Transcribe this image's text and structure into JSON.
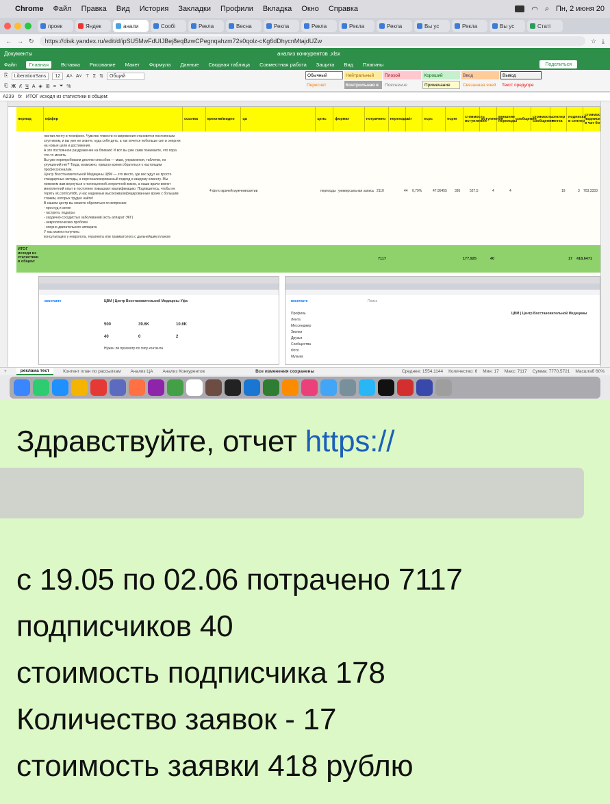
{
  "mac_menubar": {
    "app": "Chrome",
    "items": [
      "Файл",
      "Правка",
      "Вид",
      "История",
      "Закладки",
      "Профили",
      "Вкладка",
      "Окно",
      "Справка"
    ],
    "datetime": "Пн, 2 июня 20"
  },
  "browser": {
    "tabs": [
      "проек",
      "Яндек",
      "анали",
      "Сообі",
      "Рекла",
      "Весна",
      "Рекла",
      "Рекла",
      "Рекла",
      "Рекла",
      "Вы ус",
      "Рекла",
      "Вы ус",
      "Статі"
    ],
    "active_tab_index": 2,
    "url": "https://disk.yandex.ru/edit/d/ipSU5MwFdUIJBej8eqBzwCPegnqahzm72s0qolz-cKg6dDhycnMtajdUZw"
  },
  "spreadsheet": {
    "app_label": "Документы",
    "file_name": "анализ конкурентов .xlsx",
    "share_label": "Поделиться",
    "menus": [
      "Файл",
      "Главная",
      "Вставка",
      "Рисование",
      "Макет",
      "Формула",
      "Данные",
      "Сводная таблица",
      "Совместная работа",
      "Защита",
      "Вид",
      "Плагины"
    ],
    "active_menu": "Главная",
    "font_name": "LiberationSans",
    "font_size": "12",
    "number_format": "Общий",
    "styles_row1": [
      "Обычный",
      "Нейтральный",
      "Плохой",
      "Хороший",
      "Ввод",
      "Вывод"
    ],
    "styles_row2": [
      "Пересчет",
      "Контрольная я",
      "Пояснение",
      "Примечание",
      "Связанная ячей",
      "Текст предупре"
    ],
    "cell_ref": "A239",
    "formula": "ИТОГ исходя из статистики в общем:",
    "headers": [
      "период",
      "оффер",
      "ссылка",
      "креатив/видео",
      "ца",
      "цель",
      "формат",
      "потрачено",
      "переходы",
      "ctr",
      "ecpc",
      "ecpm",
      "стоимость вступления",
      "вступления",
      "внешние переходы",
      "сообщения",
      "стоимость сообщения",
      "сенлер метка",
      "подписки в сенлер",
      "стоимость подписки в чат бот"
    ],
    "offer_text": [
      "листая ленту в телефоне. Чувство тяжести и напряжения становятся постоянным",
      "спутником, и вы уже не знаете, куда себя деть, а так хочется побольше сил и энергии",
      "на новые цели и достижения.",
      "А это постоянное раздражение на близких! И вот вы уже сами понимаете, что пора",
      "что-то менять.",
      "Вы уже перепробовали десятки способов — мази, упражнения, таблетки, но",
      "улучшений нет? Тогда, возможно, пришло время обратиться к настоящим",
      "профессионалам.",
      "Центр Восстановительной Медицины ЦВМ — это место, где вас ждут не просто",
      "стандартные методы, а персонализированный подход к каждому клиенту. Мы",
      "поможем вам вернуться к полноценной энергичной жизни, а наши врачи имеют",
      "многолетний опыт и постоянно повышают квалификацию. Подпишитесь, чтобы не",
      "терять vk.com/cvm86, у нас надежные высококвалифицированные врачи с большим",
      "стажем, которых трудно найти!",
      "В нашем центр вы можете обратиться по вопросам:",
      "- простуд и ангин",
      "- гастрита, подагры",
      "- сердечно-сосудистых заболеваний (есть аппарат ЭКГ)",
      "- неврологических проблем",
      "- опорно-двигательного аппарата",
      "У нас можно получить:",
      "консультацию у невролога, терапевта или травматолога с дальнейшим планом"
    ],
    "data_row": {
      "creative": "4 фото врачей мужчин",
      "audience": "позитив",
      "goal": "переходы",
      "format": "универсальная запись",
      "spent": "2110",
      "clicks": "44",
      "ctr": "0,79%",
      "ecpc": "47,95455",
      "ecpm": "395",
      "join_cost": "527,5",
      "joins": "4",
      "ext_clicks": "4",
      "senler_subs": "19",
      "sub_cost": "3",
      "bot_cost": "703,3333"
    },
    "total_row": {
      "label": "ИТОГ исходя из статистики в общем:",
      "spent": "7117",
      "sub_cost": "177,925",
      "subs": "40",
      "requests": "17",
      "request_cost": "418,6471"
    },
    "sheet_tabs": [
      "реклама тест",
      "Контент план по рассылкам",
      "Анализ ЦА",
      "Анализ Конкурентов"
    ],
    "save_status": "Все изменения сохранены",
    "status_values": [
      "Среднее: 1554,1144",
      "Количество: 6",
      "Мин: 17",
      "Макс: 7117",
      "Сумма: 7770,5721",
      "Масштаб 60%"
    ]
  },
  "embedded_left": {
    "header": "вконтакте",
    "title": "ЦВМ | Центр Восстановительной Медицины Уфа",
    "stats": [
      "500",
      "39.6K",
      "10.6K",
      "40",
      "0",
      "2"
    ],
    "notice": "Нужен ли просмотр по типу контента"
  },
  "embedded_right": {
    "header": "вконтакте",
    "search_placeholder": "Поиск",
    "menu": [
      "Профиль",
      "Лента",
      "Мессенджер",
      "Звонки",
      "Друзья",
      "Сообщества",
      "Фото",
      "Музыка"
    ],
    "chat_title": "ЦВМ | Центр Восстановительной Медицины"
  },
  "message": {
    "greeting": "Здравствуйте, отчет ",
    "link": "https://",
    "lines": [
      "с 19.05 по 02.06 потрачено 7117",
      "подписчиков 40",
      "стоимость подписчика 178",
      "Количество заявок - 17",
      "стоимость заявки 418 рублю"
    ]
  },
  "colors": {
    "message_bg": "#dcf8c6",
    "link": "#1c5fb8",
    "sheet_green": "#2d8f49",
    "header_yellow": "#fffb00",
    "total_green": "#8fd26b"
  }
}
